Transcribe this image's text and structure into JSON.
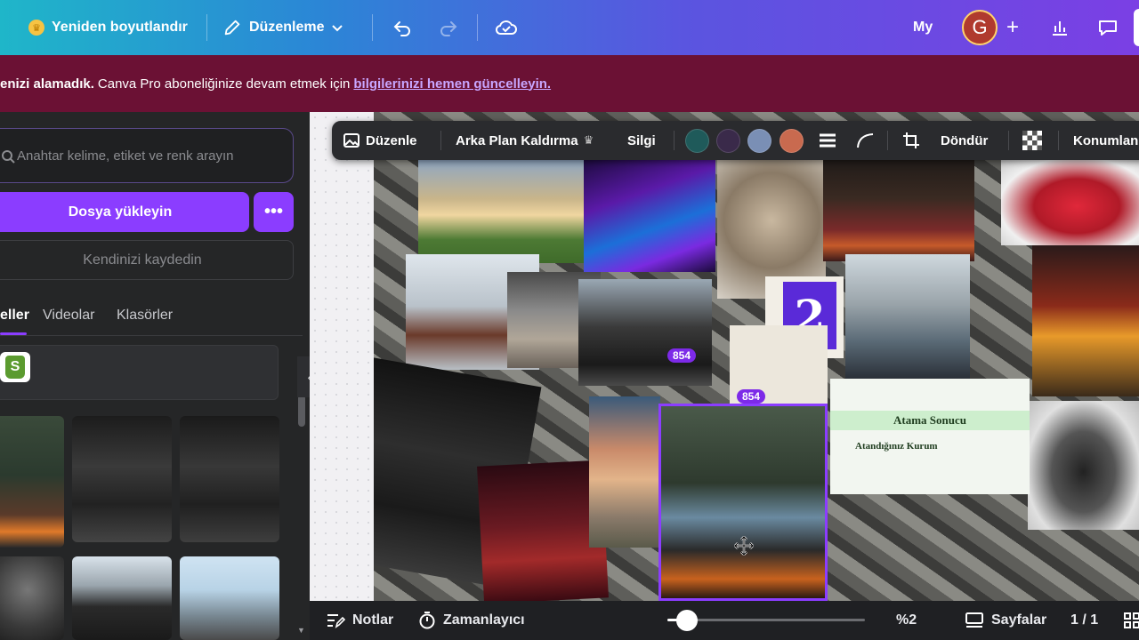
{
  "topbar": {
    "resize_label": "Yeniden boyutlandır",
    "edit_label": "Düzenleme",
    "my_label": "My",
    "avatar_initial": "G"
  },
  "banner": {
    "prefix_bold": "enizi alamadık.",
    "message": "Canva Pro aboneliğinize devam etmek için",
    "link": "bilgilerinizi hemen güncelleyin."
  },
  "panel": {
    "search_placeholder": "Anahtar kelime, etiket ve renk arayın",
    "upload_label": "Dosya yükleyin",
    "more_label": "•••",
    "record_label": "Kendinizi kaydedin",
    "tabs": [
      {
        "label": "eller"
      },
      {
        "label": "Videolar"
      },
      {
        "label": "Klasörler"
      }
    ]
  },
  "toolbar": {
    "edit_label": "Düzenle",
    "bg_remove_label": "Arka Plan Kaldırma",
    "eraser_label": "Silgi",
    "rotate_label": "Döndür",
    "position_label": "Konumlan",
    "swatch_colors": [
      "#1f5a5a",
      "#3a2a4a",
      "#7a8fb5",
      "#c96a4f"
    ]
  },
  "canvas": {
    "badge_1": "854",
    "badge_2": "854",
    "card_title": "Atama Sonucu",
    "card_subtitle": "Atandığınız Kurum",
    "sticker_text": "2"
  },
  "bottombar": {
    "notes_label": "Notlar",
    "timer_label": "Zamanlayıcı",
    "zoom_label": "%2",
    "zoom_fraction": 0.1,
    "pages_label": "Sayfalar",
    "page_count": "1 / 1"
  }
}
